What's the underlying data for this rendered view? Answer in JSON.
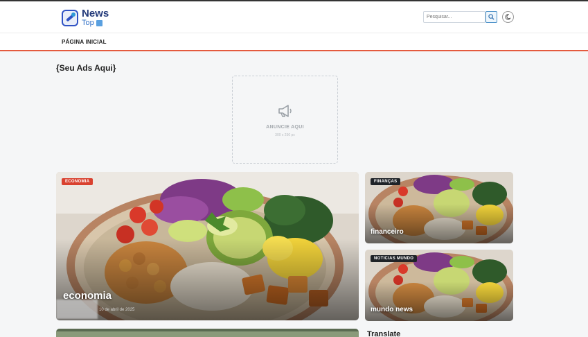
{
  "header": {
    "logo_news": "News",
    "logo_top": "Top",
    "search_placeholder": "Pesquisar..."
  },
  "nav": {
    "home_label": "PÁGINA INICIAL"
  },
  "ads": {
    "title": "{Seu Ads Aqui}",
    "label": "ANUNCIE AQUI",
    "size": "300 x 250 px"
  },
  "featured": {
    "main": {
      "badge": "ECONOMIA",
      "title": "economia",
      "date": "10 de abril de 2025"
    },
    "side1": {
      "badge": "FINANÇAS",
      "title": "financeiro"
    },
    "side2": {
      "badge": "NOTICIAS MUNDO",
      "title": "mundo news"
    }
  },
  "sidebar": {
    "translate_title": "Translate"
  },
  "colors": {
    "accent": "#e45a3e",
    "badge_red": "#d9412f",
    "badge_dark": "#1f2328",
    "brand": "#243a7a"
  },
  "icons": {
    "logo": "news-logo-icon",
    "search": "search-icon",
    "theme": "moon-icon",
    "ad": "megaphone-icon"
  }
}
